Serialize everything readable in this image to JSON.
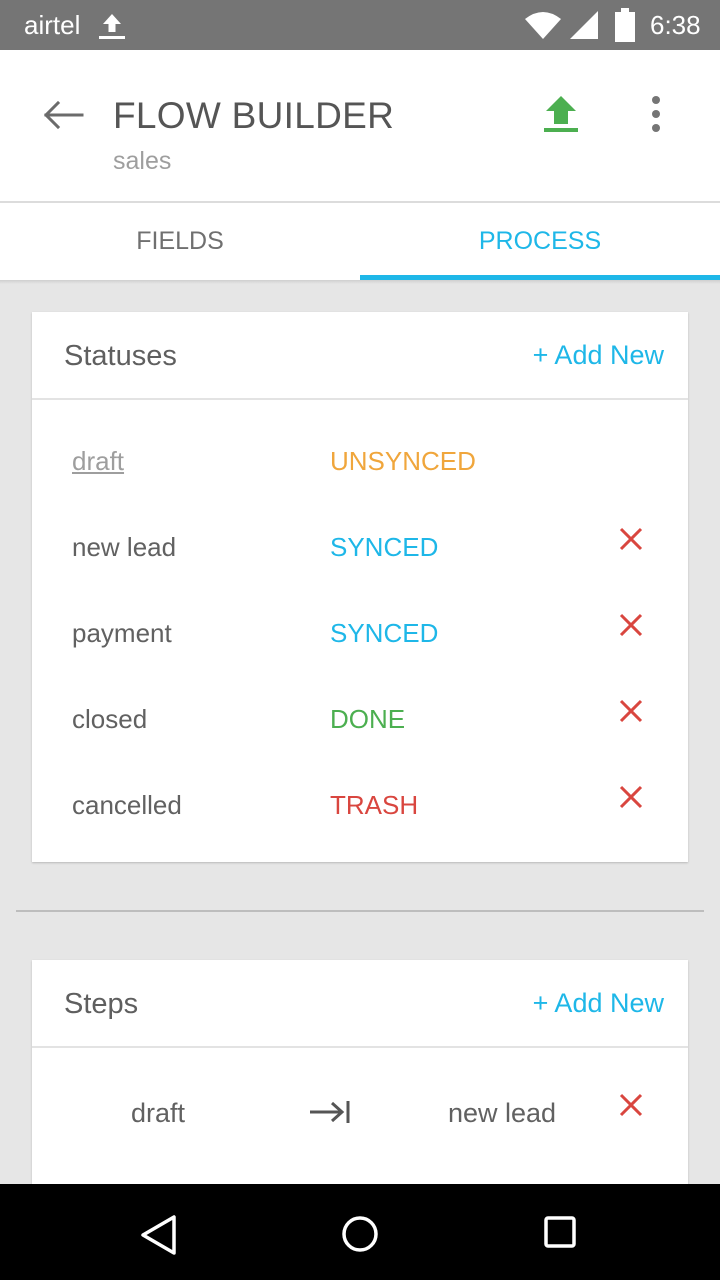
{
  "status_bar": {
    "carrier": "airtel",
    "time": "6:38"
  },
  "app_bar": {
    "title": "FLOW BUILDER",
    "subtitle": "sales"
  },
  "tabs": [
    {
      "label": "FIELDS",
      "active": false
    },
    {
      "label": "PROCESS",
      "active": true
    }
  ],
  "statuses": {
    "title": "Statuses",
    "add_label": "+ Add New",
    "items": [
      {
        "name": "draft",
        "state": "UNSYNCED",
        "color": "#f0a63c",
        "deletable": false
      },
      {
        "name": "new lead",
        "state": "SYNCED",
        "color": "#1eb7e8",
        "deletable": true
      },
      {
        "name": "payment",
        "state": "SYNCED",
        "color": "#1eb7e8",
        "deletable": true
      },
      {
        "name": "closed",
        "state": "DONE",
        "color": "#4caf50",
        "deletable": true
      },
      {
        "name": "cancelled",
        "state": "TRASH",
        "color": "#d9463f",
        "deletable": true
      }
    ]
  },
  "steps": {
    "title": "Steps",
    "add_label": "+ Add New",
    "items": [
      {
        "from": "draft",
        "to": "new lead"
      }
    ]
  },
  "colors": {
    "accent": "#1eb7e8",
    "upload_icon": "#4caf50",
    "delete_icon": "#d9463f",
    "status_bar": "#757575"
  },
  "icons": {
    "back": "arrow-left-icon",
    "upload": "upload-icon",
    "menu": "more-vert-icon",
    "delete": "close-icon",
    "step_arrow": "arrow-to-right-icon"
  }
}
